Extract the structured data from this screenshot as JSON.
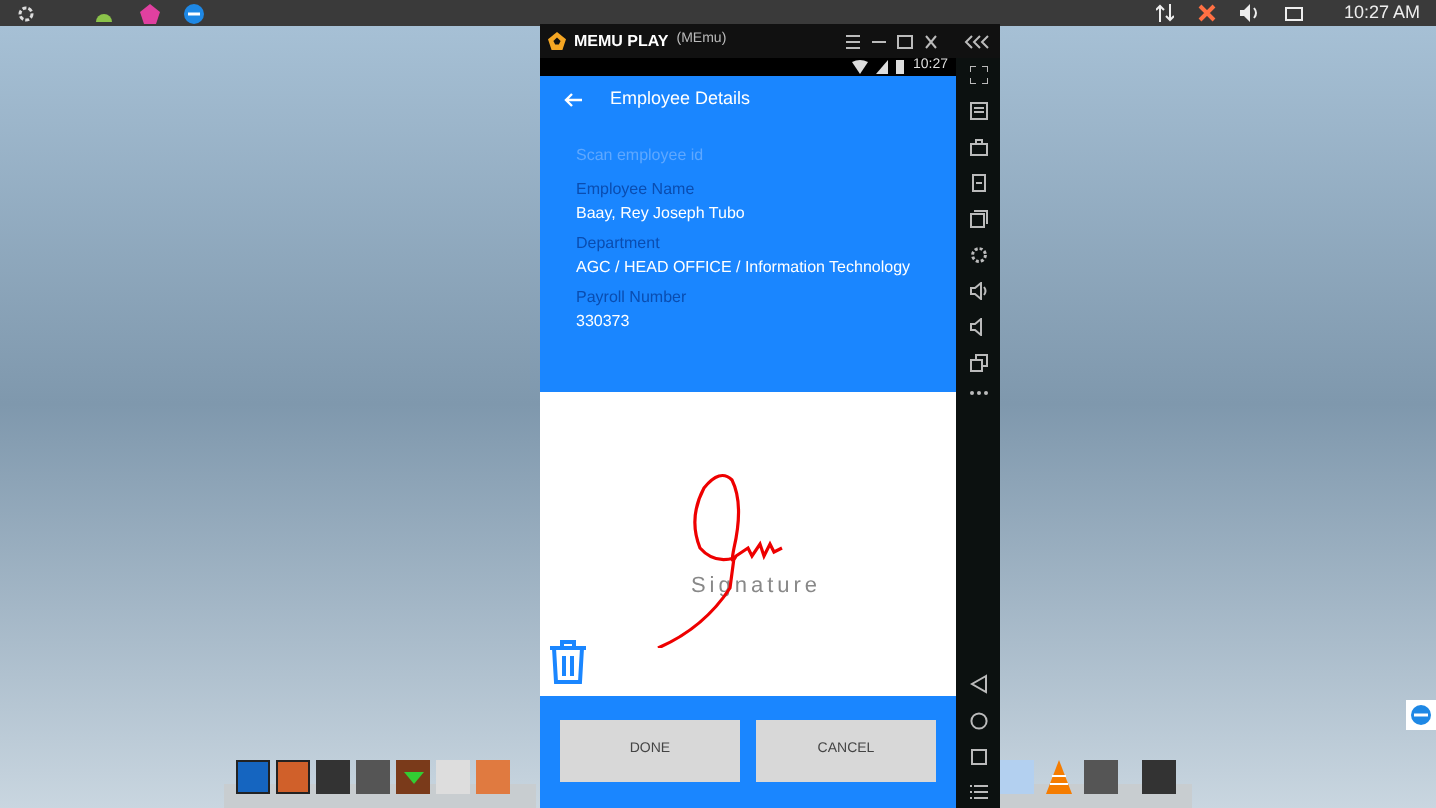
{
  "taskbar": {
    "clock": "10:27 AM"
  },
  "emulator": {
    "title": "MEMU PLAY",
    "subtitle": "(MEmu)",
    "status_time": "10:27"
  },
  "app": {
    "title": "Employee Details",
    "search": {
      "placeholder": "Scan employee id"
    },
    "fields": [
      {
        "label": "Employee Name",
        "value": "Baay, Rey Joseph Tubo"
      },
      {
        "label": "Department",
        "value": "AGC / HEAD OFFICE / Information Technology"
      },
      {
        "label": "Payroll Number",
        "value": "330373"
      }
    ],
    "signature": {
      "hint": "Signature"
    },
    "buttons": [
      "DONE",
      "CANCEL"
    ]
  }
}
